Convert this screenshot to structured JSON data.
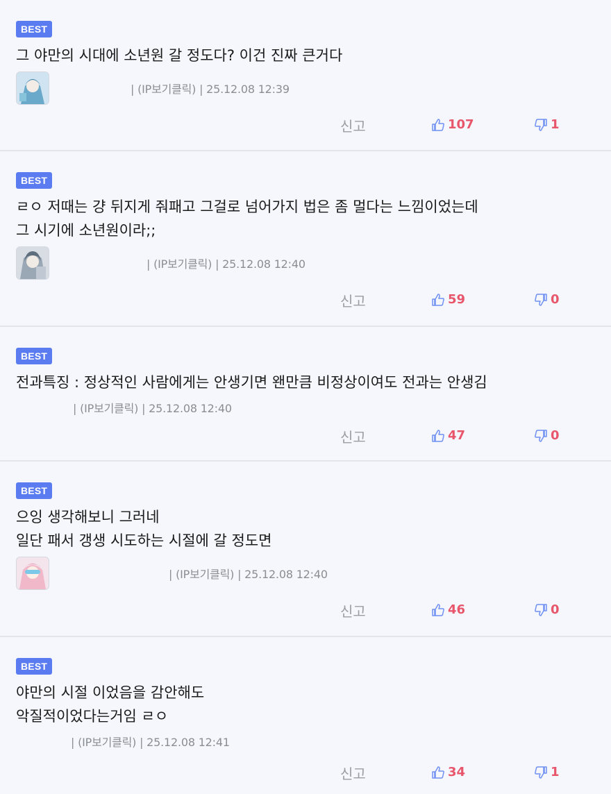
{
  "labels": {
    "badge": "BEST",
    "report": "신고"
  },
  "colors": {
    "badge_bg": "#5b7cf0",
    "vote_count": "#e8566b",
    "thumb_icon": "#6f8ff2",
    "meta_text": "#8a8d93"
  },
  "comments": [
    {
      "text": "그 야만의 시대에 소년원 갈 정도다? 이건 진짜 큰거다",
      "meta": "| (IP보기클릭) | 25.12.08 12:39",
      "has_avatar": true,
      "avatar_icon": "avatar-anime-character-icon",
      "likes": "107",
      "dislikes": "1"
    },
    {
      "text": "ㄹㅇ 저때는 걍 뒤지게 줘패고 그걸로 넘어가지 법은 좀 멀다는 느낌이었는데\n그 시기에 소년원이라;;",
      "meta": "| (IP보기클릭) | 25.12.08 12:40",
      "has_avatar": true,
      "avatar_icon": "avatar-anime-character-icon",
      "likes": "59",
      "dislikes": "0"
    },
    {
      "text": "전과특징 : 정상적인 사람에게는 안생기면 왠만큼 비정상이여도 전과는 안생김",
      "meta": "| (IP보기클릭) | 25.12.08 12:40",
      "has_avatar": false,
      "likes": "47",
      "dislikes": "0"
    },
    {
      "text": "으잉 생각해보니 그러네\n일단 패서 갱생 시도하는 시절에 갈 정도면",
      "meta": "| (IP보기클릭) | 25.12.08 12:40",
      "has_avatar": true,
      "avatar_icon": "avatar-anime-character-icon",
      "likes": "46",
      "dislikes": "0"
    },
    {
      "text": "야만의 시절 이었음을 감안해도\n악질적이었다는거임 ㄹㅇ",
      "meta": "| (IP보기클릭) | 25.12.08 12:41",
      "has_avatar": false,
      "likes": "34",
      "dislikes": "1"
    }
  ]
}
